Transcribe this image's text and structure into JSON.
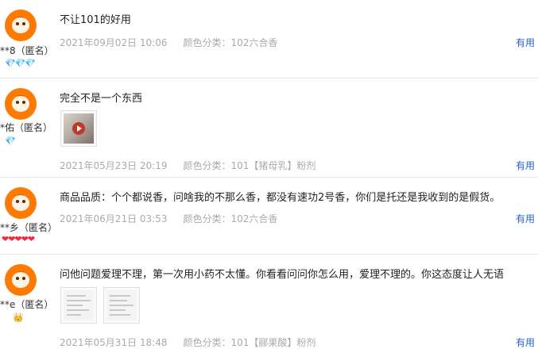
{
  "reviews": [
    {
      "user": "**8（匿名）",
      "badge": "💎💎💎",
      "content": "不让101的好用",
      "date": "2021年09月02日 10:06",
      "sku": "颜色分类：102六合香",
      "useful": "有用"
    },
    {
      "user": "*佑（匿名）",
      "badge": "💎",
      "content": "完全不是一个东西",
      "media": [
        "video-thumbnail"
      ],
      "date": "2021年05月23日 20:19",
      "sku": "颜色分类：101【猪母乳】粉剂",
      "useful": "有用"
    },
    {
      "user": "**乡（匿名）",
      "badge": "❤❤❤❤❤",
      "content": "商品品质：个个都说香，问啥我的不那么香，都没有速功2号香，你们是托还是我收到的是假货。",
      "date": "2021年06月21日 03:53",
      "sku": "颜色分类：102六合香",
      "useful": "有用"
    },
    {
      "user": "**e（匿名）",
      "badge": "👑",
      "content": "问他问题爱理不理，第一次用小药不太懂。你看看问问你怎么用，爱理不理的。你这态度让人无语",
      "media": [
        "document-image",
        "document-image"
      ],
      "date": "2021年05月31日 18:48",
      "sku": "颜色分类：101【郦果酸】粉剂",
      "useful": "有用"
    }
  ],
  "colors": {
    "avatar": "#ff7a00",
    "link": "#2563c9",
    "meta": "#aaaaaa",
    "diamond": "#2aa3e6",
    "heart": "#f0283c",
    "crown": "#e8a400"
  }
}
